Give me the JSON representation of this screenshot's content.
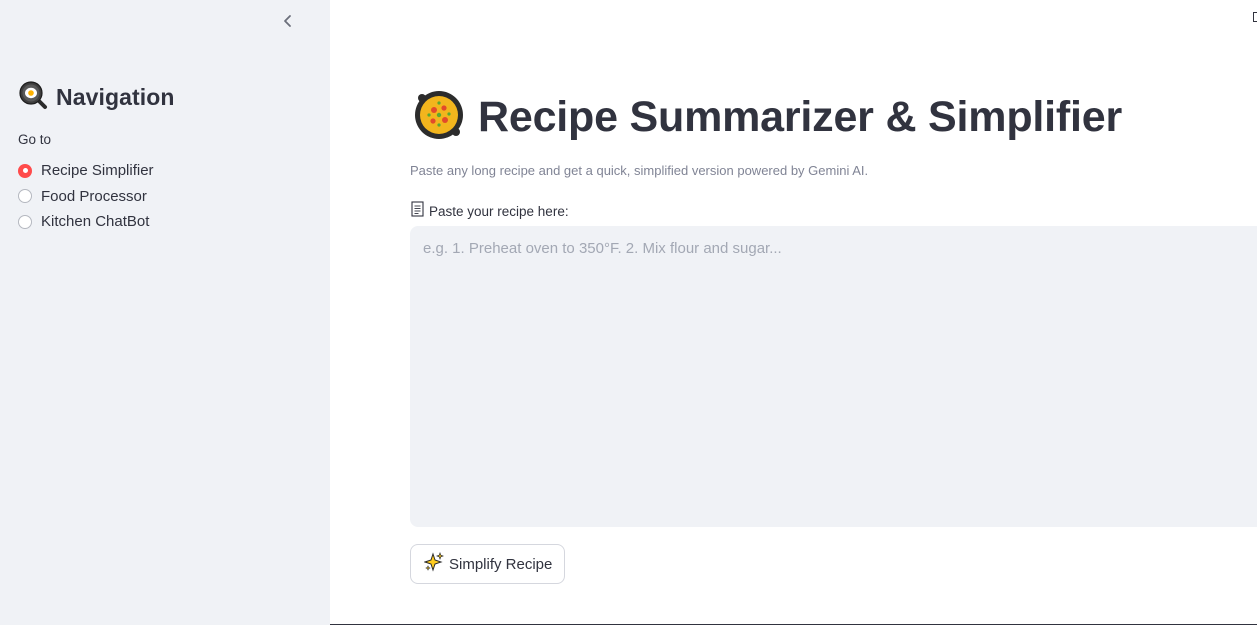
{
  "sidebar": {
    "header": {
      "title": "Navigation",
      "icon": "frying-pan-egg-icon"
    },
    "collapse_icon": "chevron-left-icon",
    "goto_label": "Go to",
    "options": [
      {
        "label": "Recipe Simplifier",
        "selected": true
      },
      {
        "label": "Food Processor",
        "selected": false
      },
      {
        "label": "Kitchen ChatBot",
        "selected": false
      }
    ]
  },
  "main": {
    "title": "Recipe Summarizer & Simplifier",
    "title_icon": "paella-pan-icon",
    "subtitle": "Paste any long recipe and get a quick, simplified version powered by Gemini AI.",
    "recipe_field": {
      "icon": "page-document-icon",
      "label": "Paste your recipe here:",
      "value": "",
      "placeholder": "e.g. 1. Preheat oven to 350°F. 2. Mix flour and sugar..."
    },
    "button": {
      "icon": "sparkles-icon",
      "label": "Simplify Recipe"
    }
  },
  "colors": {
    "sidebar_bg": "#f0f2f6",
    "accent": "#ff4b4b",
    "text": "#31333f",
    "muted_text": "#808495",
    "input_bg": "#f0f2f6"
  }
}
